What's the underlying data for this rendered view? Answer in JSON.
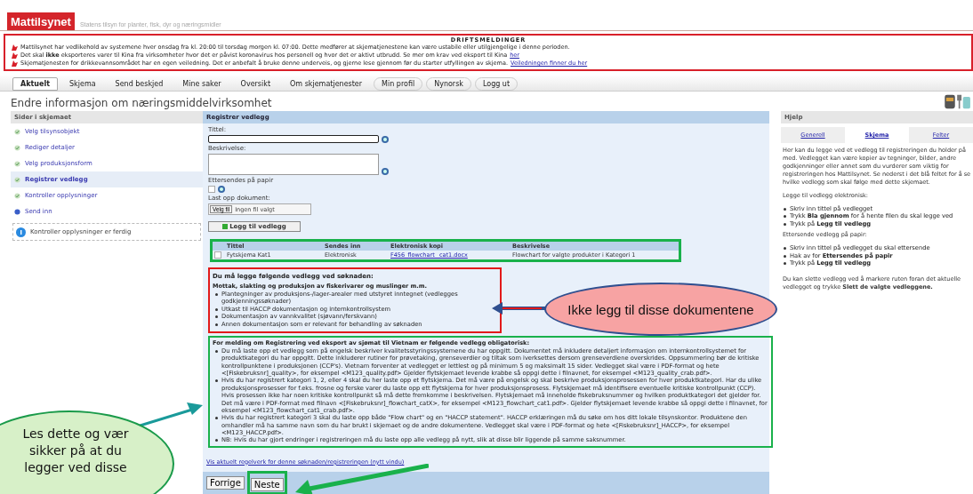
{
  "logo": {
    "name": "Mattilsynet",
    "tagline": "Statens tilsyn for planter, fisk, dyr og næringsmidler"
  },
  "notices": {
    "title": "DRIFTSMELDINGER",
    "items": [
      {
        "text": "Mattilsynet har vedlikehold av systemene hver onsdag fra kl. 20:00 til torsdag morgen kl. 07:00. Dette medfører at skjematjenestene kan være ustabile eller utilgjengelige i denne perioden."
      },
      {
        "text": "Det skal **ikke** eksporteres varer til Kina fra virksomheter hvor det er påvist koronavirus hos personell og hvor det er aktivt utbrudd. Se mer om krav ved eksport til Kina",
        "link": "her"
      },
      {
        "text": "Skjematjenesten for drikkevannsområdet har en egen veiledning. Det er anbefalt å bruke denne underveis, og gjerne lese gjennom før du starter utfyllingen av skjema.",
        "link": "Veiledningen finner du her"
      }
    ]
  },
  "nav": [
    {
      "label": "Aktuelt",
      "kind": "tab",
      "selected": true
    },
    {
      "label": "Skjema",
      "kind": "tab",
      "selected": false
    },
    {
      "label": "Send beskjed",
      "kind": "tab",
      "selected": false
    },
    {
      "label": "Mine saker",
      "kind": "tab",
      "selected": false
    },
    {
      "label": "Oversikt",
      "kind": "tab",
      "selected": false
    },
    {
      "label": "Om skjematjenester",
      "kind": "tab",
      "selected": false
    },
    {
      "label": "Min profil",
      "kind": "pill",
      "selected": false
    },
    {
      "label": "Nynorsk",
      "kind": "pill",
      "selected": false
    },
    {
      "label": "Logg ut",
      "kind": "pill",
      "selected": false
    }
  ],
  "page_title": "Endre informasjon om næringsmiddelvirksomhet",
  "sidebar": {
    "title": "Sider i skjemaet",
    "items": [
      {
        "label": "Velg tilsynsobjekt",
        "kind": "check",
        "selected": false
      },
      {
        "label": "Rediger detaljer",
        "kind": "check",
        "selected": false
      },
      {
        "label": "Velg produksjonsform",
        "kind": "check",
        "selected": false
      },
      {
        "label": "Registrer vedlegg",
        "kind": "check",
        "selected": true
      },
      {
        "label": "Kontroller opplysninger",
        "kind": "check",
        "selected": false
      },
      {
        "label": "Send inn",
        "kind": "dot",
        "selected": false
      }
    ],
    "info": "Kontroller opplysninger er ferdig"
  },
  "form": {
    "title": "Registrer vedlegg",
    "title_label": "Tittel:",
    "description_label": "Beskrivelse:",
    "paper_label": "Ettersendes på papir",
    "paper_checked": false,
    "upload_label": "Last opp dokument:",
    "file_button": "Velg fil",
    "file_status": "Ingen fil valgt",
    "add_button": "Legg til vedlegg"
  },
  "attachments": {
    "columns": [
      "Tittel",
      "Sendes inn",
      "Elektronisk kopi",
      "Beskrivelse"
    ],
    "rows": [
      {
        "checked": false,
        "title": "Fytskjema Kat1",
        "sent": "Elektronisk",
        "file": "F456_flowchart _cat1.docx",
        "description": "Flowchart for valgte produkter i Kategori 1"
      }
    ]
  },
  "required": {
    "title": "Du må legge følgende vedlegg ved søknaden:",
    "subtitle": "Mottak, slakting og produksjon av fiskerivarer og muslinger m.m.",
    "items": [
      "Plantegninger av produksjons-/lager-arealer med utstyret inntegnet (vedlegges godkjenningssøknader)",
      "Utkast til HACCP dokumentasjon og internkontrollsystem",
      "Dokumentasjon av vannkvalitet (sjøvann/ferskvann)",
      "Annen dokumentasjon som er relevant for behandling av søknaden"
    ]
  },
  "vietnam": {
    "title": "For melding om Registrering ved eksport av sjømat til Vietnam er følgende vedlegg obligatorisk:",
    "items": [
      "Du må laste opp et vedlegg som på engelsk beskriver kvalitetsstyringssystemene du har oppgitt. Dokumentet må inkludere detaljert informasjon om internkontrollsystemet for produktkategori du har oppgitt. Dette inkluderer rutiner for prøvetaking, grenseverdier og tiltak som iverksettes dersom grenseverdiene overskrides. Oppsummering bør de kritiske kontrollpunktene i produksjonen (CCP's). Vietnam forventer at vedlegget er lettlest og på minimum 5 og maksimalt 15 sider. Vedlegget skal være i PDF-format og hete <[Fiskebruksnr]_quality>, for eksempel <M123_quality.pdf> Gjelder flytskjemaet levende krabbe så oppgi dette i filnavnet, for eksempel <M123_quality_crab.pdf>.",
      "Hvis du har registrert kategori 1, 2, eller 4 skal du her laste opp et flytskjema. Det må være på engelsk og skal beskrive produksjonsprosessen for hver produktkategori. Har du ulike produksjonsprosesser for f.eks. frosne og ferske varer du laste opp ett flytskjema for hver produksjonsprosess. Flytskjemaet må identifisere eventuelle kritiske kontrollpunkt (CCP). Hvis prosessen ikke har noen kritiske kontrollpunkt så må dette fremkomme i beskrivelsen. Flytskjemaet må inneholde fiskebruksnummer og hvilken produktkategori det gjelder for. Det må være i PDF-format med filnavn <[Fiskebruksnr]_flowchart_catX>, for eksempel <M123_flowchart_cat1.pdf>. Gjelder flytskjemaet levende krabbe så oppgi dette i filnavnet, for eksempel <M123_flowchart_cat1_crab.pdf>.",
      "Hvis du har registrert kategori 3 skal du laste opp både \"Flow chart\" og en \"HACCP statement\". HACCP erklæringen må du søke om hos ditt lokale tilsynskontor. Produktene den omhandler må ha samme navn som du har brukt i skjemaet og de andre dokumentene. Vedlegget skal være i PDF-format og hete <[Fiskebruksnr]_HACCP>, for eksempel <M123_HACCP.pdf>.",
      "NB: Hvis du har gjort endringer i registreringen må du laste opp alle vedlegg på nytt, slik at disse blir liggende på samme saksnummer."
    ]
  },
  "rules_link": "Vis aktuelt regelverk for denne søknaden/registreringen (nytt vindu)",
  "buttons": [
    "Forrige",
    "Neste"
  ],
  "help": {
    "title": "Hjelp",
    "tabs": [
      {
        "label": "Generell",
        "selected": false
      },
      {
        "label": "Skjema",
        "selected": true
      },
      {
        "label": "Felter",
        "selected": false
      }
    ],
    "intro": "Her kan du legge ved et vedlegg til registreringen du holder på med. Vedlegget kan være kopier av tegninger, bilder, andre godkjenninger eller annet som du vurderer som viktig for registreringen hos Mattilsynet. Se nederst i det blå feltet for å se hvilke vedlegg som skal følge med dette skjemaet.",
    "sections": [
      {
        "heading": "Legge til vedlegg elektronisk:",
        "items": [
          "Skriv inn tittel på vedlegget",
          "Trykk **Bla gjennom** for å hente filen du skal legge ved",
          "Trykk på **Legg til vedlegg**"
        ]
      },
      {
        "heading": "Ettersende vedlegg på papir:",
        "items": [
          "Skriv inn tittel på vedlegget du skal ettersende",
          "Hak av for **Ettersendes på papir**",
          "Trykk på **Legg til vedlegg**"
        ]
      }
    ],
    "outro": "Du kan slette vedlegg ved å markere ruten foran det aktuelle vedlegget og trykke **Slett de valgte vedleggene.**"
  },
  "annotations": [
    {
      "kind": "warning",
      "text": "Ikke legg til disse dokumentene"
    },
    {
      "kind": "note",
      "text": "Les dette og vær sikker på at du legger ved disse"
    }
  ]
}
